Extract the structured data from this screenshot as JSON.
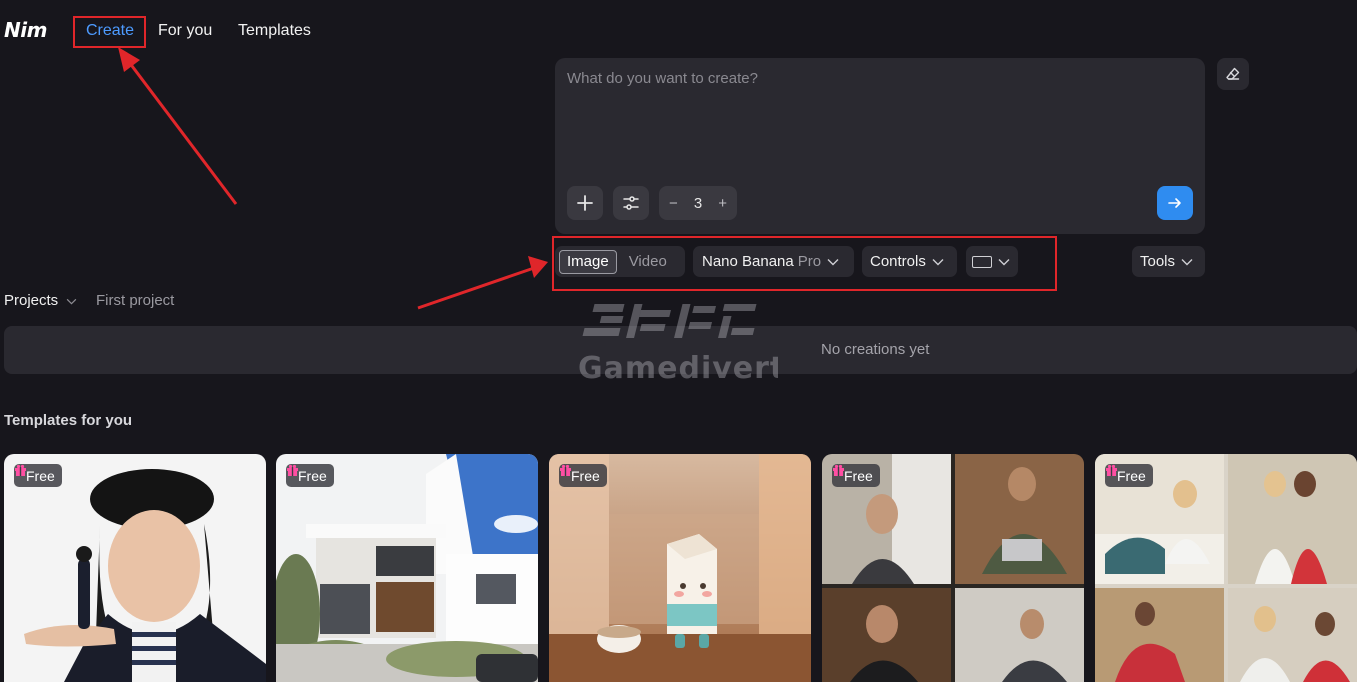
{
  "app": {
    "logo": "Nim"
  },
  "nav": {
    "create": "Create",
    "for_you": "For you",
    "templates": "Templates"
  },
  "prompt": {
    "placeholder": "What do you want to create?",
    "count": "3"
  },
  "options": {
    "mode_image": "Image",
    "mode_video": "Video",
    "model_name": "Nano Banana",
    "model_variant": "Pro",
    "controls": "Controls",
    "tools": "Tools"
  },
  "projects": {
    "label": "Projects",
    "current": "First project"
  },
  "creations": {
    "empty_text": "No creations yet"
  },
  "watermark": {
    "brand": "Gamedivert"
  },
  "templates": {
    "heading": "Templates for you",
    "cards": [
      {
        "badge": "Free"
      },
      {
        "badge": "Free"
      },
      {
        "badge": "Free"
      },
      {
        "badge": "Free"
      },
      {
        "badge": "Free"
      }
    ]
  },
  "colors": {
    "background": "#17161c",
    "panel": "#2a2930",
    "accent": "#2f8cf0",
    "active_nav": "#4d9bff",
    "annotation": "#e0262a",
    "badge_icon": "#ff4fa3"
  }
}
